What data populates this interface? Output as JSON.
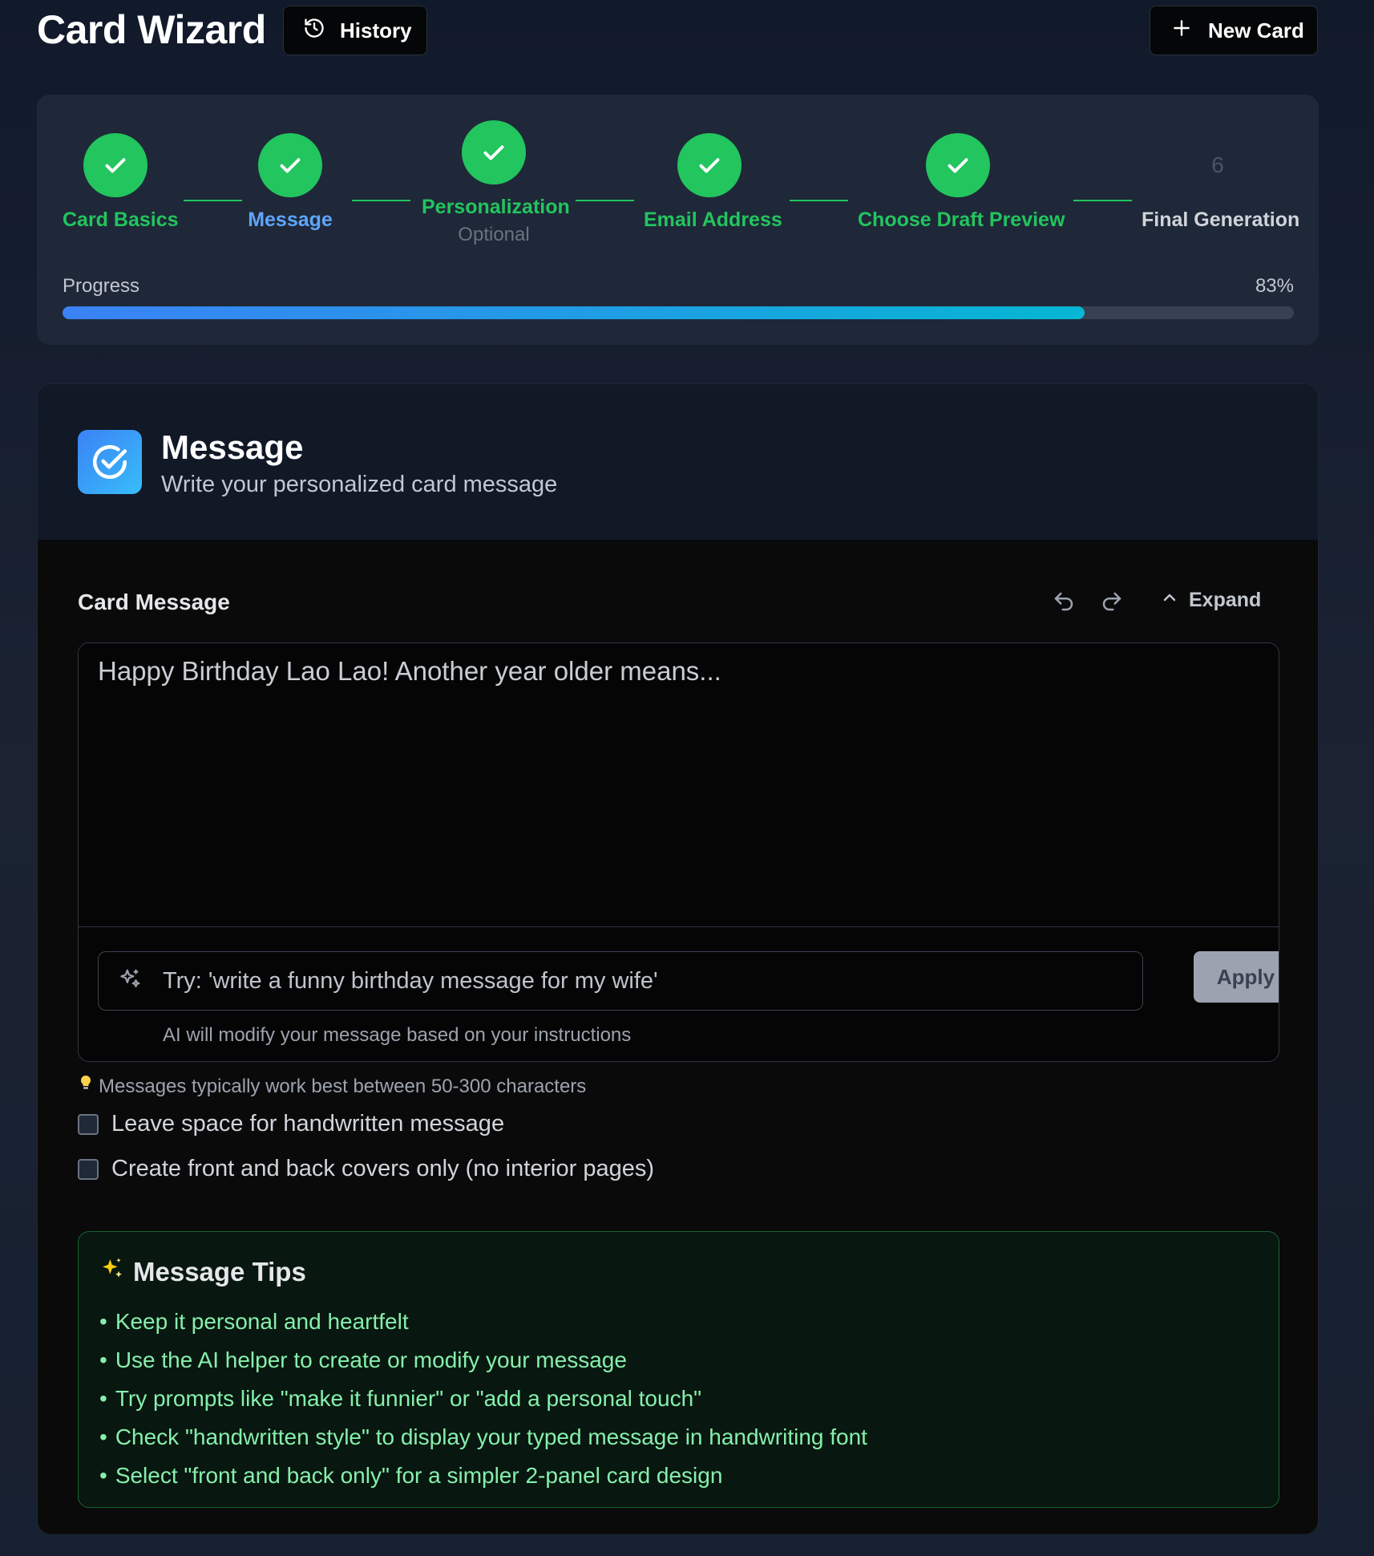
{
  "header": {
    "title": "Card Wizard",
    "history_label": "History",
    "new_card_label": "New Card"
  },
  "stepper": {
    "steps": [
      {
        "label": "Card Basics",
        "status": "complete"
      },
      {
        "label": "Message",
        "status": "current"
      },
      {
        "label": "Personalization",
        "sub": "Optional",
        "status": "complete"
      },
      {
        "label": "Email Address",
        "status": "complete"
      },
      {
        "label": "Choose Draft Preview",
        "status": "complete"
      },
      {
        "label": "Final Generation",
        "number": "6",
        "status": "pending"
      }
    ],
    "progress_label": "Progress",
    "progress_text": "83%",
    "progress_value": 0.83
  },
  "card": {
    "title": "Message",
    "subtitle": "Write your personalized card message",
    "section_label": "Card Message",
    "expand_label": "Expand",
    "message_value": "Happy Birthday Lao Lao! Another year older means...",
    "ai_placeholder": "Try: 'write a funny birthday message for my wife'",
    "apply_label": "Apply",
    "ai_hint": "AI will modify your message based on your instructions",
    "length_tip": "Messages typically work best between 50-300 characters",
    "checkbox_handwritten": "Leave space for handwritten message",
    "checkbox_covers": "Create front and back covers only (no interior pages)"
  },
  "tips": {
    "title": "Message Tips",
    "items": [
      "Keep it personal and heartfelt",
      "Use the AI helper to create or modify your message",
      "Try prompts like \"make it funnier\" or \"add a personal touch\"",
      "Check \"handwritten style\" to display your typed message in handwriting font",
      "Select \"front and back only\" for a simpler 2-panel card design"
    ]
  },
  "colors": {
    "accent_green": "#22c55e",
    "accent_blue": "#3b82f6",
    "active_step": "#60a5fa",
    "tips_text": "#86efac"
  }
}
